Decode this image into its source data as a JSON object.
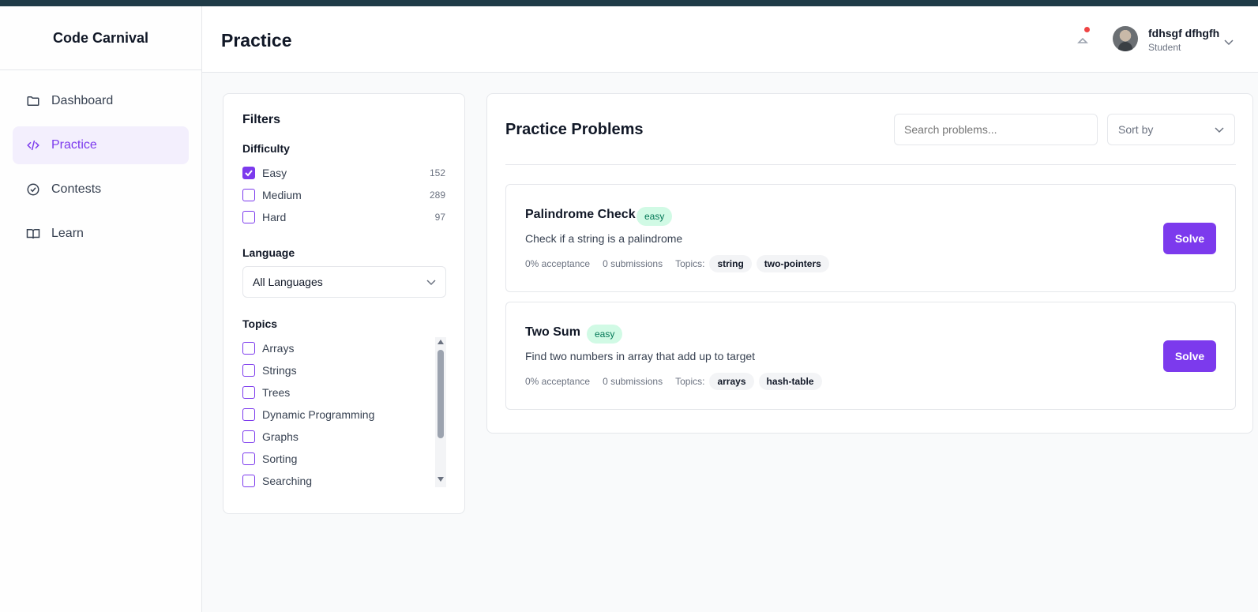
{
  "app": {
    "brand": "Code Carnival"
  },
  "sidebar": {
    "items": [
      {
        "label": "Dashboard",
        "icon": "folder-icon",
        "active": false
      },
      {
        "label": "Practice",
        "icon": "code-icon",
        "active": true
      },
      {
        "label": "Contests",
        "icon": "check-circle-icon",
        "active": false
      },
      {
        "label": "Learn",
        "icon": "book-icon",
        "active": false
      }
    ]
  },
  "header": {
    "title": "Practice",
    "user": {
      "name": "fdhsgf dfhgfh",
      "role": "Student"
    }
  },
  "filters": {
    "title": "Filters",
    "difficulty": {
      "label": "Difficulty",
      "options": [
        {
          "label": "Easy",
          "count": "152",
          "checked": true
        },
        {
          "label": "Medium",
          "count": "289",
          "checked": false
        },
        {
          "label": "Hard",
          "count": "97",
          "checked": false
        }
      ]
    },
    "language": {
      "label": "Language",
      "selected": "All Languages"
    },
    "topics": {
      "label": "Topics",
      "options": [
        "Arrays",
        "Strings",
        "Trees",
        "Dynamic Programming",
        "Graphs",
        "Sorting",
        "Searching"
      ]
    }
  },
  "problems": {
    "title": "Practice Problems",
    "search_placeholder": "Search problems...",
    "sort_label": "Sort by",
    "solve_label": "Solve",
    "topics_label": "Topics:",
    "items": [
      {
        "title": "Palindrome Check",
        "difficulty": "easy",
        "description": "Check if a string is a palindrome",
        "acceptance": "0% acceptance",
        "submissions": "0 submissions",
        "tags": [
          "string",
          "two-pointers"
        ]
      },
      {
        "title": "Two Sum",
        "difficulty": "easy",
        "description": "Find two numbers in array that add up to target",
        "acceptance": "0% acceptance",
        "submissions": "0 submissions",
        "tags": [
          "arrays",
          "hash-table"
        ]
      }
    ]
  },
  "colors": {
    "accent": "#7c3aed",
    "topbar": "#1f3b47",
    "easy_badge_bg": "#d1fae5",
    "easy_badge_text": "#047857"
  }
}
